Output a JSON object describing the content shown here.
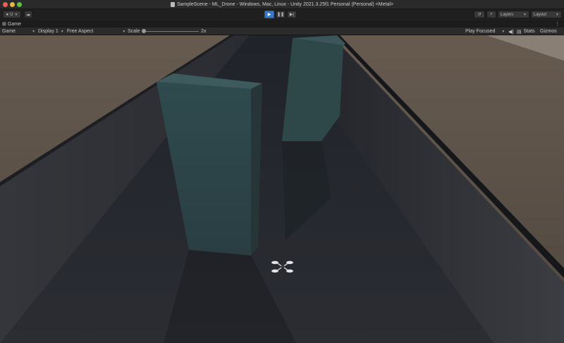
{
  "window": {
    "title": "SampleScene - ML_Drone - Windows, Mac, Linux - Unity 2021.3.25f1 Personal (Personal) <Metal>"
  },
  "toolbar": {
    "account_label": "U",
    "layers_label": "Layers",
    "layout_label": "Layout"
  },
  "game_view": {
    "tab_label": "Game",
    "view_mode": "Game",
    "display": "Display 1",
    "aspect": "Free Aspect",
    "scale_label": "Scale",
    "scale_value": "2x",
    "play_mode": "Play Focused",
    "stats_label": "Stats",
    "gizmos_label": "Gizmos"
  },
  "colors": {
    "play_active": "#3b79c6",
    "ground": "#5f544a",
    "walls": "#2a2d32",
    "pillars": "#2f4a4c"
  },
  "icons": [
    "apple-close",
    "apple-minimize",
    "apple-maximize",
    "scene-file-icon",
    "account-icon",
    "cloud-icon",
    "play-icon",
    "pause-icon",
    "step-icon",
    "history-icon",
    "search-icon",
    "game-icon",
    "kebab-menu-icon",
    "audio-icon",
    "drone-icon"
  ]
}
